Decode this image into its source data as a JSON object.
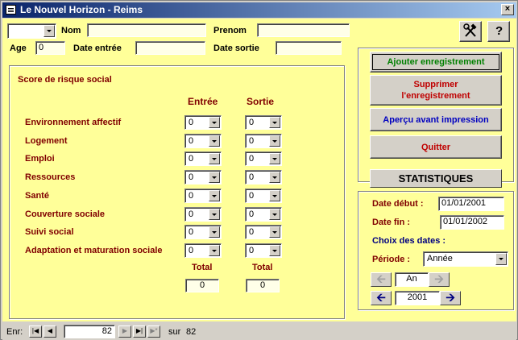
{
  "window": {
    "title": "Le Nouvel Horizon - Reims",
    "close": "×"
  },
  "header": {
    "combo_value": "",
    "nom_label": "Nom",
    "nom_value": "",
    "prenom_label": "Prenom",
    "prenom_value": "",
    "age_label": "Age",
    "age_value": "0",
    "date_entree_label": "Date entrée",
    "date_entree_value": "",
    "date_sortie_label": "Date sortie",
    "date_sortie_value": "",
    "tools_icon": "hammer-wrench-icon",
    "help_icon": "question-icon",
    "help_glyph": "?"
  },
  "score": {
    "title": "Score de risque social",
    "col_entree": "Entrée",
    "col_sortie": "Sortie",
    "rows": [
      {
        "label": "Environnement affectif",
        "entree": "0",
        "sortie": "0"
      },
      {
        "label": "Logement",
        "entree": "0",
        "sortie": "0"
      },
      {
        "label": "Emploi",
        "entree": "0",
        "sortie": "0"
      },
      {
        "label": "Ressources",
        "entree": "0",
        "sortie": "0"
      },
      {
        "label": "Santé",
        "entree": "0",
        "sortie": "0"
      },
      {
        "label": "Couverture sociale",
        "entree": "0",
        "sortie": "0"
      },
      {
        "label": "Suivi social",
        "entree": "0",
        "sortie": "0"
      },
      {
        "label": "Adaptation et maturation sociale",
        "entree": "0",
        "sortie": "0"
      }
    ],
    "total_label_entree": "Total",
    "total_label_sortie": "Total",
    "total_entree": "0",
    "total_sortie": "0"
  },
  "actions": {
    "add": "Ajouter enregistrement",
    "delete_line1": "Supprimer",
    "delete_line2": "l'enregistrement",
    "preview": "Aperçu avant impression",
    "quit": "Quitter",
    "colors": {
      "add": "#008000",
      "delete": "#c00000",
      "preview": "#0000c0",
      "quit": "#c00000"
    }
  },
  "stats": {
    "button": "STATISTIQUES",
    "date_debut_label": "Date début :",
    "date_debut": "01/01/2001",
    "date_fin_label": "Date fin :",
    "date_fin": "01/01/2002",
    "choix_label": "Choix des dates :",
    "periode_label": "Période :",
    "periode_value": "Année",
    "unit": "An",
    "year": "2001",
    "left_arrow_icon": "arrow-left-icon",
    "right_arrow_icon": "arrow-right-icon"
  },
  "statusbar": {
    "label": "Enr:",
    "current": "82",
    "of_label": "sur",
    "total": "82"
  }
}
